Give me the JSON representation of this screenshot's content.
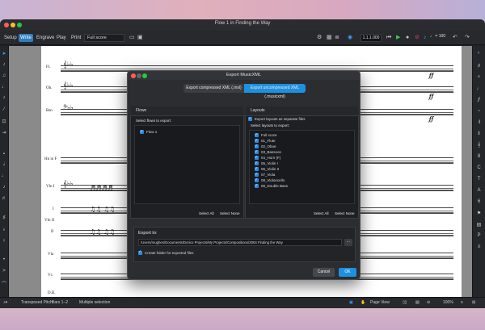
{
  "window": {
    "title": "Flow 1 in Finding the Way"
  },
  "toolbar": {
    "modes": [
      "Setup",
      "Write",
      "Engrave",
      "Play",
      "Print"
    ],
    "active_mode": "Write",
    "layout_select": "Full score",
    "counter": "1.1.1.000",
    "tempo": "♩ = 100"
  },
  "score": {
    "instruments": [
      "Fl.",
      "Ob.",
      "Bsn",
      "Hn in F",
      "Vln I",
      "I",
      "Vln II",
      "II",
      "Vla",
      "Vc.",
      "D.B."
    ]
  },
  "dialog": {
    "title": "Export MusicXML",
    "format_options": [
      "Export compressed XML (.mxl)",
      "Export uncompressed XML (.musicxml)"
    ],
    "selected_format": "Export uncompressed XML (.musicxml)",
    "flows": {
      "heading": "Flows",
      "subheading": "Select flows to export:",
      "items": [
        "Flow 1"
      ],
      "select_all": "Select All",
      "select_none": "Select None"
    },
    "layouts": {
      "heading": "Layouts",
      "separate_files_label": "Export layouts as separate files",
      "subheading": "Select layouts to export:",
      "items": [
        "Full score",
        "01_Flute",
        "02_Oboe",
        "03_Bassoon",
        "04_Horn (F)",
        "05_Violin I",
        "06_Violin II",
        "07_Viola",
        "08_Violoncello",
        "09_Double Bass"
      ],
      "select_all": "Select All",
      "select_none": "Select None"
    },
    "export_to": {
      "label": "Export to:",
      "path": "/Users/mughes/Documents/Dorico Projects/My Projects/Compositions/2004 Finding the Way",
      "browse": "...",
      "create_folder_label": "Create folder for exported files"
    },
    "cancel": "Cancel",
    "ok": "OK"
  },
  "statusbar": {
    "pitch_mode": "Transposed Pitch",
    "bars": "Bars 1–2",
    "selection": "Multiple selection",
    "view": "Page View",
    "zoom": "100%"
  },
  "colors": {
    "accent": "#1e90e0",
    "panel": "#2b2d31"
  }
}
